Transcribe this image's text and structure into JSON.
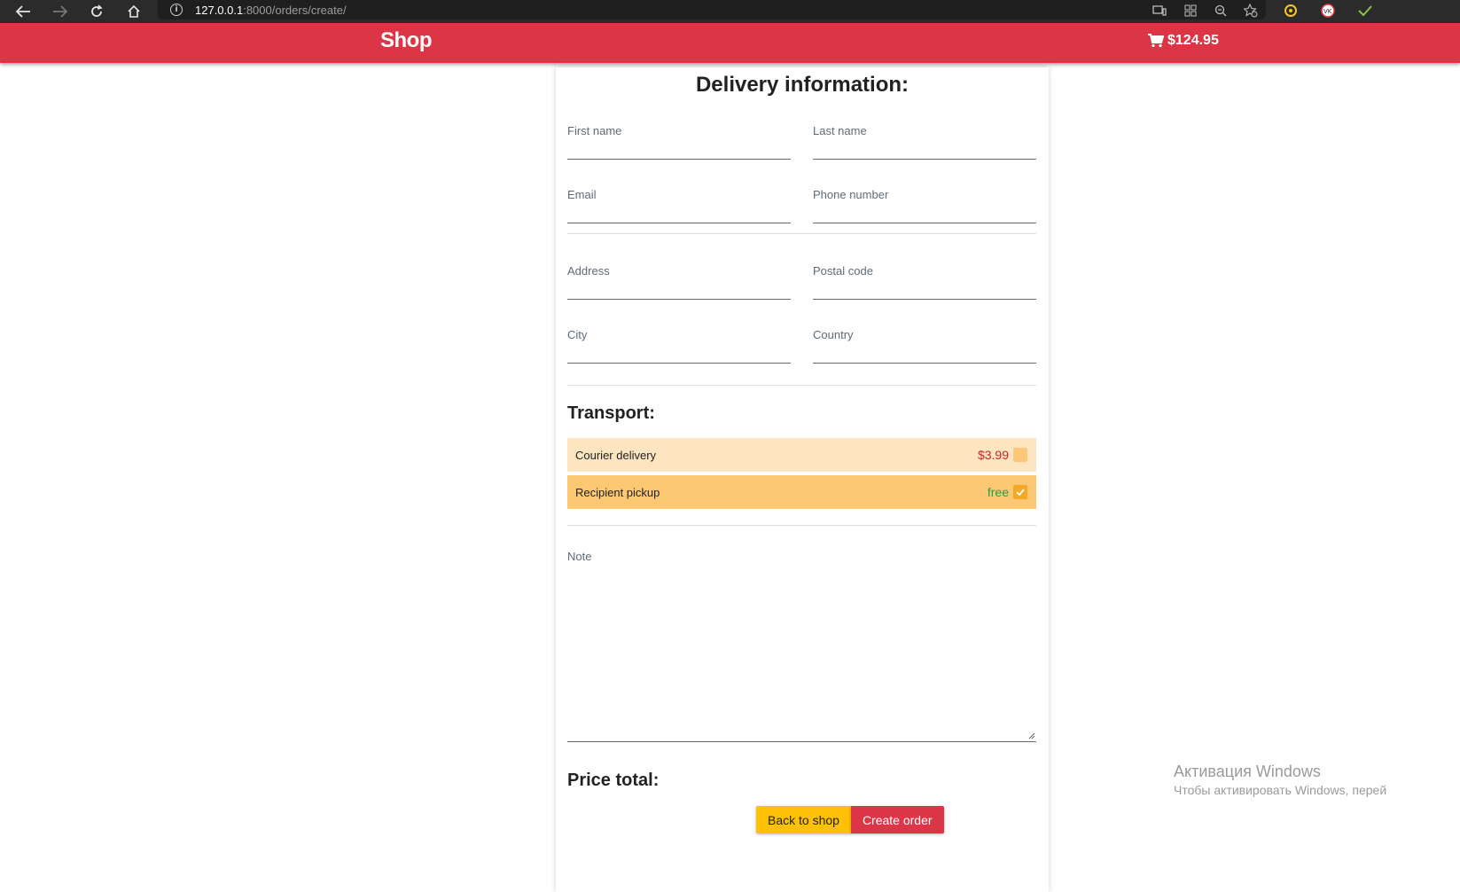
{
  "browser": {
    "url_host": "127.0.0.1",
    "url_rest": ":8000/orders/create/"
  },
  "header": {
    "brand": "Shop",
    "cart_total": "$124.95",
    "accent_color": "#dc3545"
  },
  "form": {
    "title": "Delivery information:",
    "fields": {
      "first_name": "First name",
      "last_name": "Last name",
      "email": "Email",
      "phone": "Phone number",
      "address": "Address",
      "postal_code": "Postal code",
      "city": "City",
      "country": "Country"
    },
    "transport": {
      "title": "Transport:",
      "options": [
        {
          "label": "Courier delivery",
          "price": "$3.99",
          "checked": false
        },
        {
          "label": "Recipient pickup",
          "price": "free",
          "checked": true
        }
      ]
    },
    "note_label": "Note",
    "price_total_title": "Price total:",
    "back_button": "Back to shop",
    "create_button": "Create order"
  },
  "watermark": {
    "title": "Активация Windows",
    "subtitle": "Чтобы активировать Windows, перей"
  }
}
